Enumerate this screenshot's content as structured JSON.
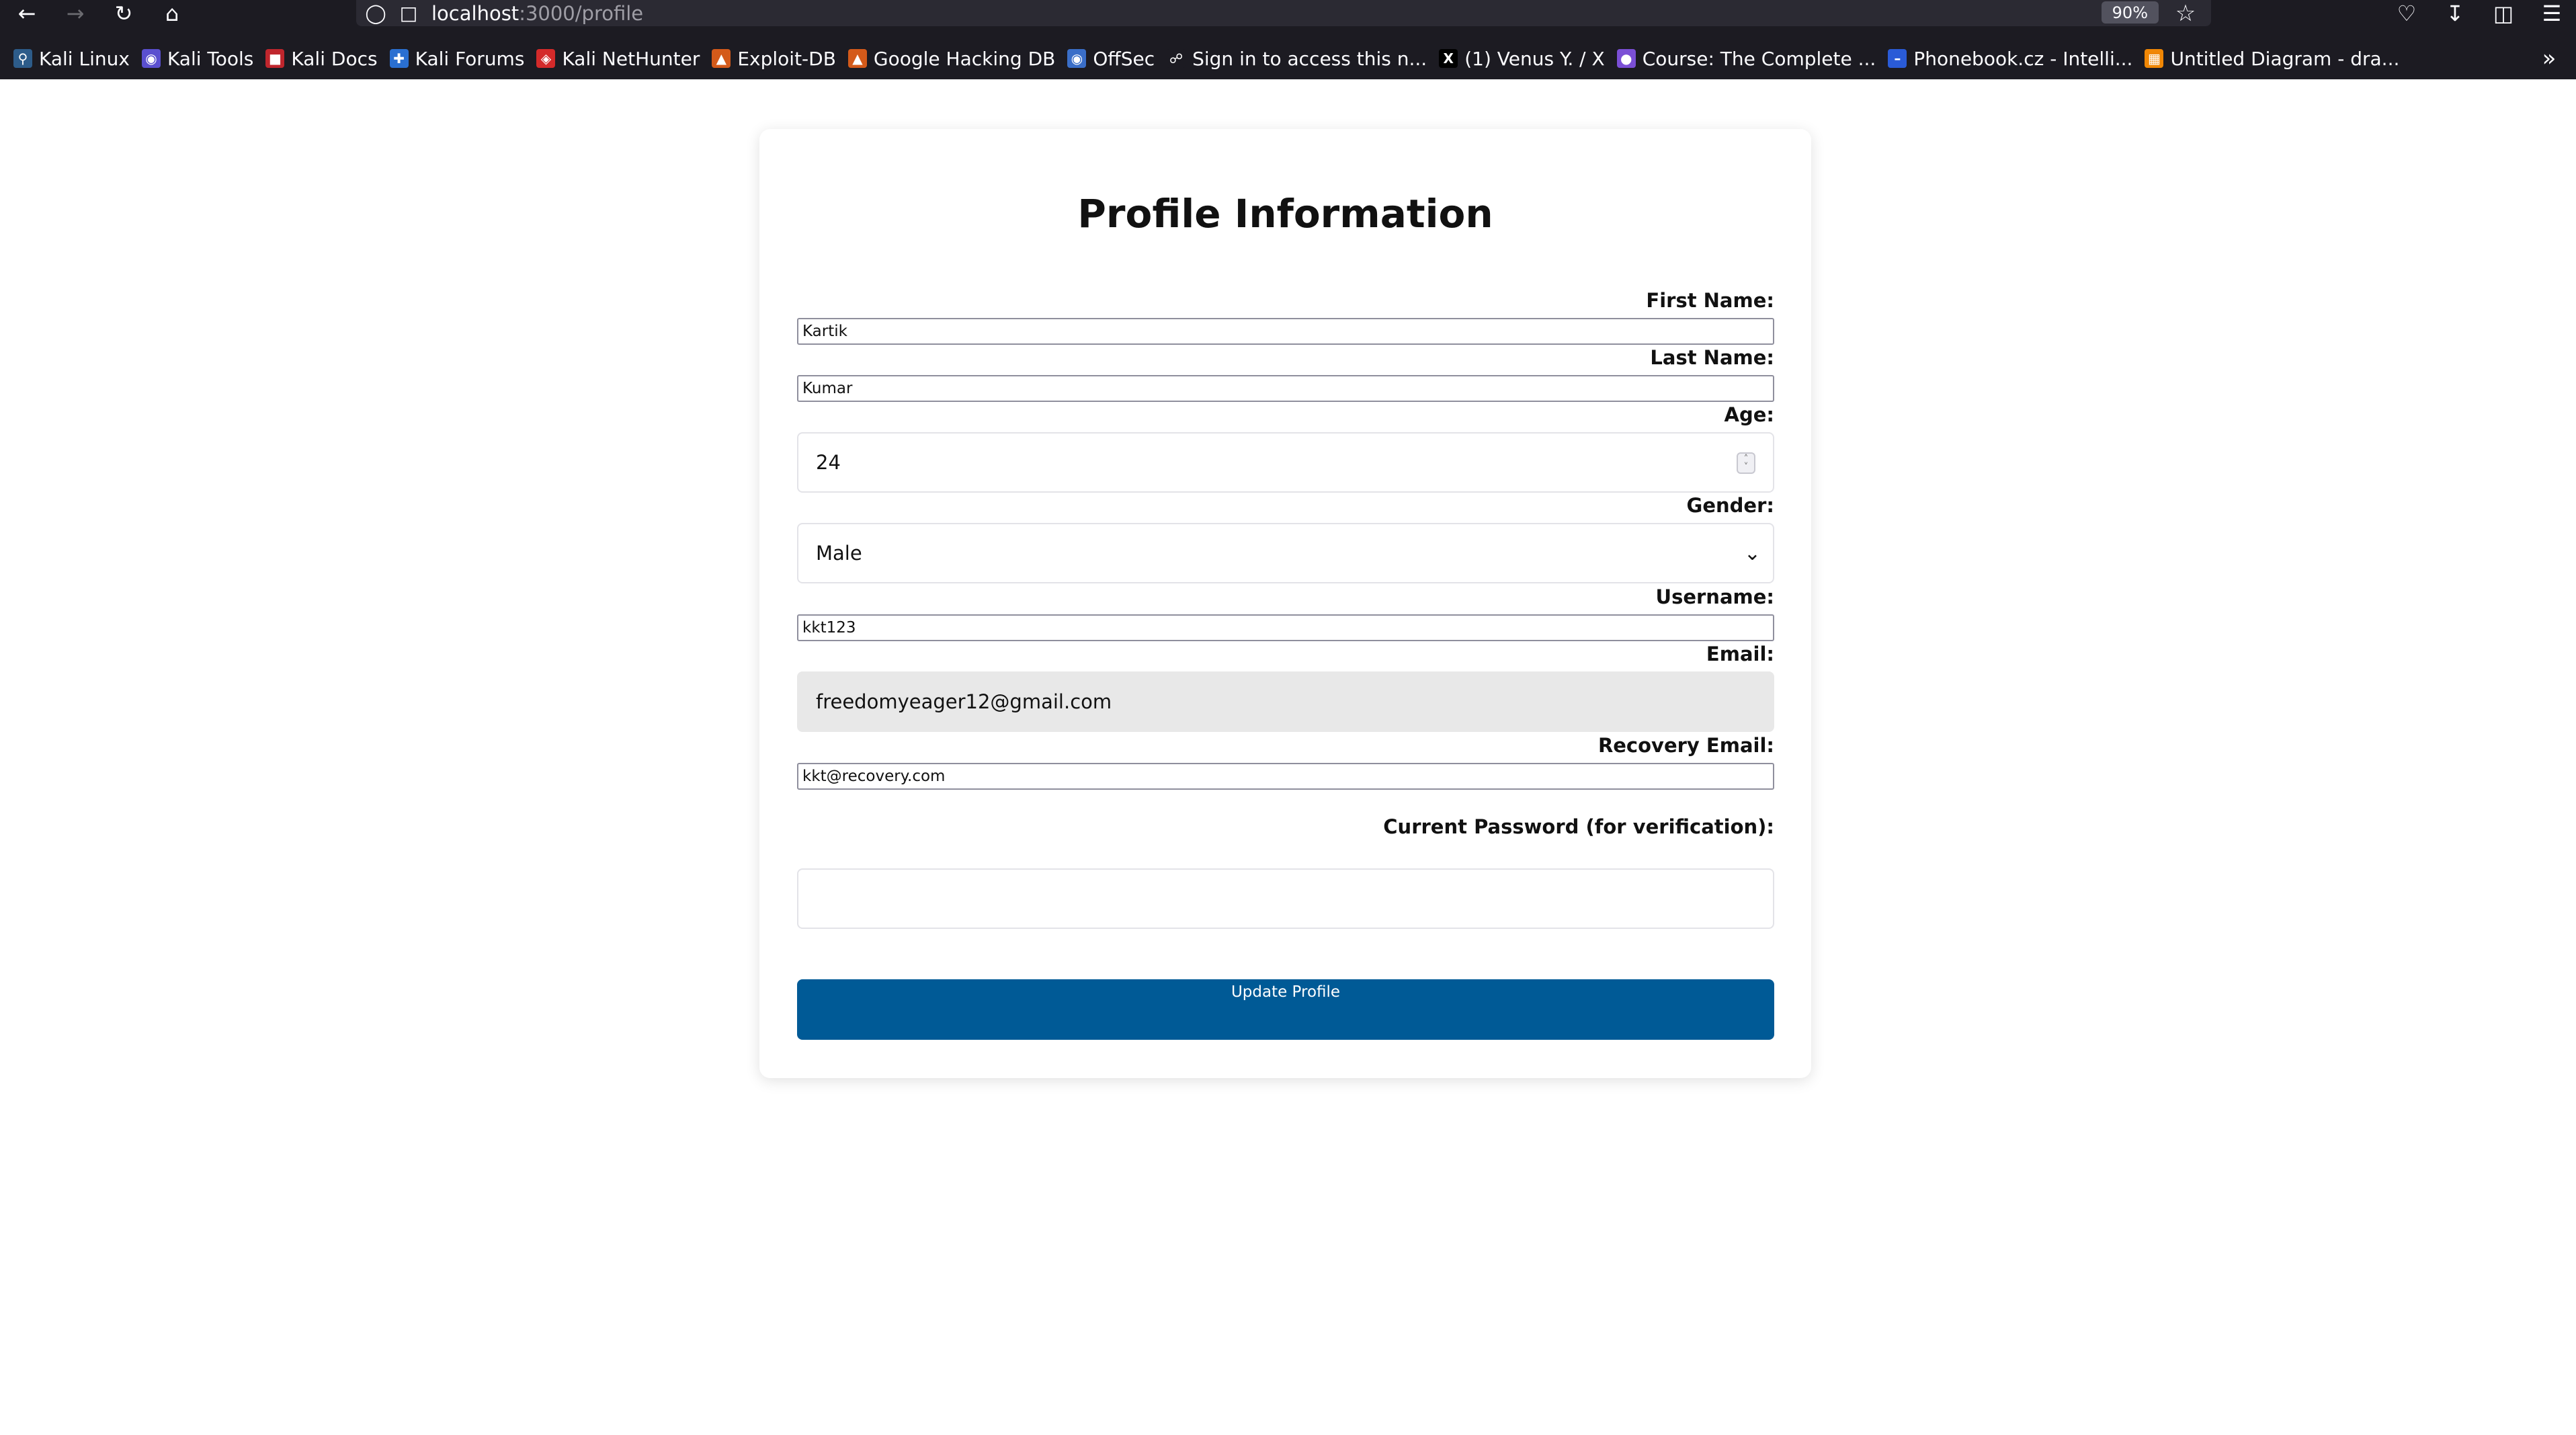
{
  "browser": {
    "url_host": "localhost",
    "url_path": ":3000/profile",
    "zoom": "90%",
    "bookmarks": [
      {
        "label": "Kali Linux",
        "icon": "kali-dragon-icon",
        "color": "#2d5c8a"
      },
      {
        "label": "Kali Tools",
        "icon": "kali-tools-icon",
        "color": "#5a4fcf"
      },
      {
        "label": "Kali Docs",
        "icon": "kali-docs-icon",
        "color": "#c0262d"
      },
      {
        "label": "Kali Forums",
        "icon": "kali-forums-icon",
        "color": "#2a6fd1"
      },
      {
        "label": "Kali NetHunter",
        "icon": "nethunter-icon",
        "color": "#d42a2a"
      },
      {
        "label": "Exploit-DB",
        "icon": "exploit-db-icon",
        "color": "#d45a1a"
      },
      {
        "label": "Google Hacking DB",
        "icon": "ghdb-icon",
        "color": "#d45a1a"
      },
      {
        "label": "OffSec",
        "icon": "offsec-icon",
        "color": "#3a6ec8"
      },
      {
        "label": "Sign in to access this n...",
        "icon": "globe-icon",
        "color": "#1c1b22"
      },
      {
        "label": "(1) Venus Y. / X",
        "icon": "x-logo-icon",
        "color": "#000000"
      },
      {
        "label": "Course: The Complete ...",
        "icon": "course-icon",
        "color": "#7b4fd6"
      },
      {
        "label": "Phonebook.cz - Intelli...",
        "icon": "phonebook-icon",
        "color": "#2a5bd7"
      },
      {
        "label": "Untitled Diagram - dra...",
        "icon": "drawio-icon",
        "color": "#f08705"
      }
    ]
  },
  "page": {
    "title": "Profile Information",
    "fields": {
      "first_name": {
        "label": "First Name:",
        "value": "Kartik"
      },
      "last_name": {
        "label": "Last Name:",
        "value": "Kumar"
      },
      "age": {
        "label": "Age:",
        "value": "24"
      },
      "gender": {
        "label": "Gender:",
        "value": "Male"
      },
      "username": {
        "label": "Username:",
        "value": "kkt123"
      },
      "email": {
        "label": "Email:",
        "value": "freedomyeager12@gmail.com"
      },
      "recovery_email": {
        "label": "Recovery Email:",
        "value": "kkt@recovery.com"
      },
      "current_password": {
        "label": "Current Password (for verification):",
        "value": ""
      }
    },
    "submit_label": "Update Profile",
    "colors": {
      "submit_bg": "#005a96",
      "disabled_bg": "#e8e8e8"
    }
  }
}
